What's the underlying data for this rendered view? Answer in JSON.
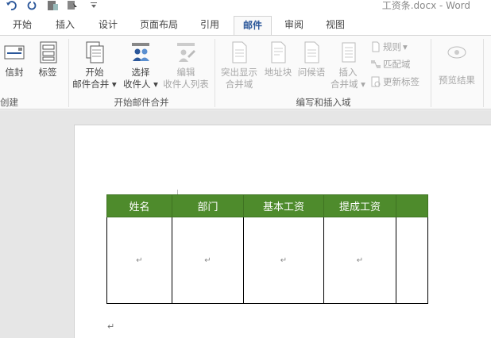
{
  "window": {
    "title": "工资条.docx - Word"
  },
  "tabs": [
    "开始",
    "插入",
    "设计",
    "页面布局",
    "引用",
    "邮件",
    "审阅",
    "视图"
  ],
  "ribbon": {
    "groups": {
      "create": "创建",
      "start_merge": "开始邮件合并",
      "write_insert": "编写和插入域"
    },
    "buttons": {
      "envelope": "信封",
      "label": "标签",
      "start_merge_1": "开始",
      "start_merge_2": "邮件合并",
      "select_recipients_1": "选择",
      "select_recipients_2": "收件人",
      "edit_list_1": "编辑",
      "edit_list_2": "收件人列表",
      "highlight_1": "突出显示",
      "highlight_2": "合并域",
      "address_block": "地址块",
      "greeting": "问候语",
      "insert_field_1": "插入",
      "insert_field_2": "合并域",
      "rules": "规则",
      "match_fields": "匹配域",
      "update_labels": "更新标签",
      "preview": "预览结果"
    }
  },
  "table": {
    "headers": [
      "姓名",
      "部门",
      "基本工资",
      "提成工资",
      ""
    ],
    "mark": "↵"
  },
  "colors": {
    "accent": "#2b579a",
    "table_header": "#4e8b2c"
  }
}
